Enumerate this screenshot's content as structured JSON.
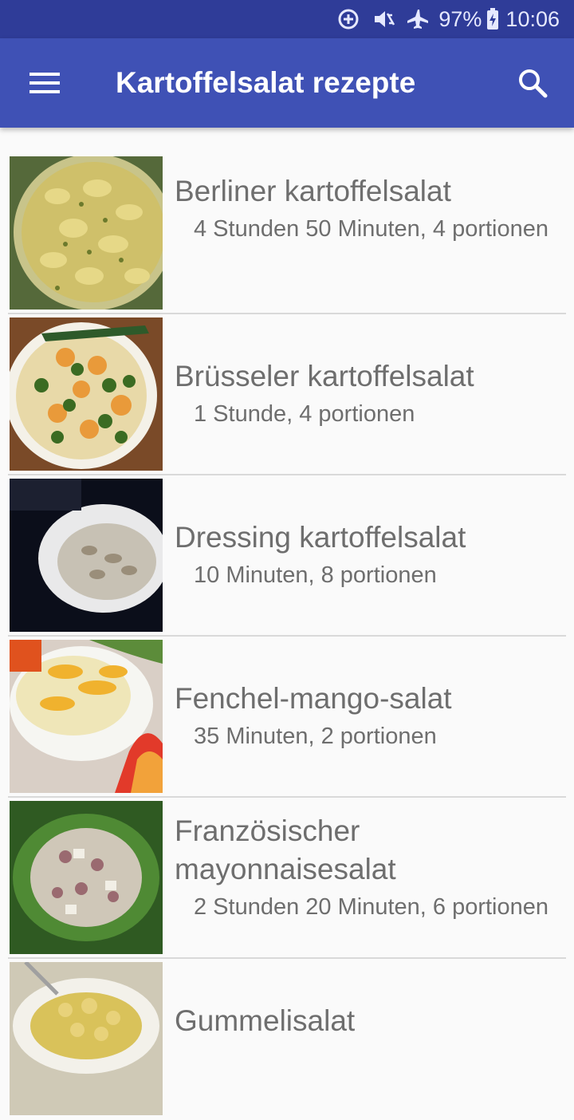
{
  "status_bar": {
    "battery": "97%",
    "time": "10:06"
  },
  "app_bar": {
    "title": "Kartoffelsalat rezepte",
    "menu_icon": "hamburger-menu-icon",
    "search_icon": "search-icon"
  },
  "recipes": [
    {
      "title": "Berliner kartoffelsalat",
      "detail": "4 Stunden 50 Minuten, 4 portionen"
    },
    {
      "title": "Brüsseler kartoffelsalat",
      "detail": "1 Stunde, 4 portionen"
    },
    {
      "title": "Dressing kartoffelsalat",
      "detail": "10 Minuten, 8 portionen"
    },
    {
      "title": "Fenchel-mango-salat",
      "detail": "35 Minuten, 2 portionen"
    },
    {
      "title": "Französischer mayonnaisesalat",
      "detail": "2 Stunden 20 Minuten, 6 portionen"
    },
    {
      "title": "Gummelisalat",
      "detail": ""
    }
  ]
}
